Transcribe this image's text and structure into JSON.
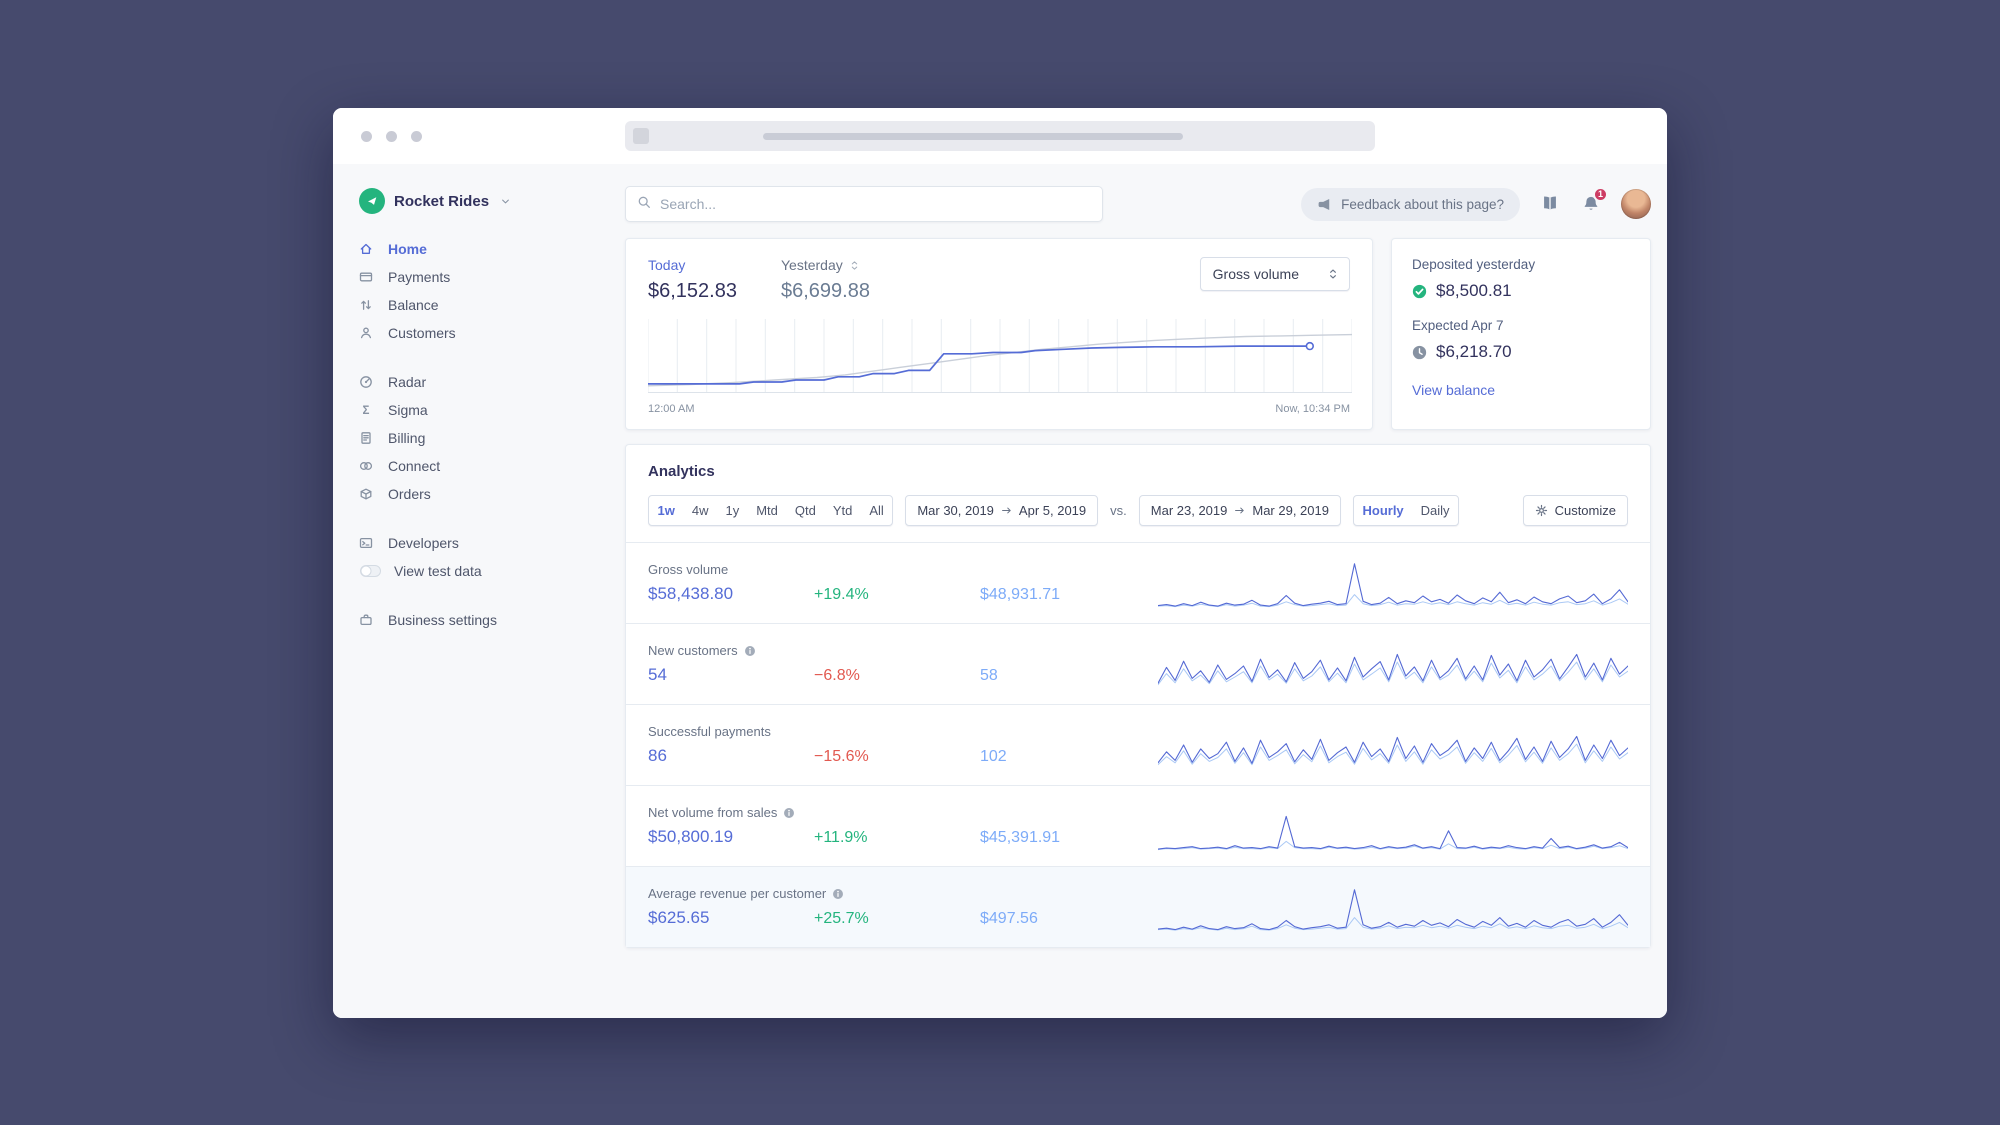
{
  "colors": {
    "accent": "#556cd6",
    "positive": "#24b47e",
    "negative": "#e25950",
    "previous_value": "#7dabf8",
    "brand_green": "#24b47e",
    "spark_current": "#5469d4",
    "spark_previous": "#abc9f5",
    "chart_yesterday": "#c9cfd9"
  },
  "sidebar": {
    "brand": {
      "name": "Rocket Rides"
    },
    "groups": [
      {
        "items": [
          {
            "label": "Home",
            "icon": "home",
            "active": true
          },
          {
            "label": "Payments",
            "icon": "payments"
          },
          {
            "label": "Balance",
            "icon": "balance"
          },
          {
            "label": "Customers",
            "icon": "customers"
          }
        ]
      },
      {
        "items": [
          {
            "label": "Radar",
            "icon": "radar"
          },
          {
            "label": "Sigma",
            "icon": "sigma"
          },
          {
            "label": "Billing",
            "icon": "billing"
          },
          {
            "label": "Connect",
            "icon": "connect"
          },
          {
            "label": "Orders",
            "icon": "orders"
          }
        ]
      },
      {
        "items": [
          {
            "label": "Developers",
            "icon": "developers"
          },
          {
            "label": "View test data",
            "icon": "toggle"
          }
        ]
      },
      {
        "items": [
          {
            "label": "Business settings",
            "icon": "settings"
          }
        ]
      }
    ]
  },
  "topbar": {
    "search_placeholder": "Search...",
    "feedback_label": "Feedback about this page?",
    "bell_badge": "1"
  },
  "overview": {
    "today_label": "Today",
    "today_value": "$6,152.83",
    "yesterday_label": "Yesterday",
    "yesterday_value": "$6,699.88",
    "metric_select": "Gross volume",
    "x_start_label": "12:00 AM",
    "x_end_label": "Now, 10:34 PM",
    "chart": {
      "type": "line",
      "gridlines": 24,
      "series": [
        {
          "name": "Yesterday",
          "points": [
            [
              0,
              5
            ],
            [
              6,
              7
            ],
            [
              12,
              10
            ],
            [
              18,
              14
            ],
            [
              24,
              18
            ],
            [
              28,
              22
            ],
            [
              32,
              28
            ],
            [
              36,
              34
            ],
            [
              40,
              40
            ],
            [
              44,
              46
            ],
            [
              48,
              52
            ],
            [
              52,
              57
            ],
            [
              56,
              62
            ],
            [
              60,
              66
            ],
            [
              64,
              70
            ],
            [
              68,
              73
            ],
            [
              72,
              76
            ],
            [
              76,
              78
            ],
            [
              80,
              80
            ],
            [
              85,
              82
            ],
            [
              90,
              83
            ],
            [
              95,
              84
            ],
            [
              100,
              85
            ]
          ]
        },
        {
          "name": "Today",
          "end_dot": true,
          "points": [
            [
              0,
              8
            ],
            [
              13,
              8
            ],
            [
              15,
              11
            ],
            [
              19,
              11
            ],
            [
              21,
              14
            ],
            [
              25,
              14
            ],
            [
              27,
              19
            ],
            [
              30,
              19
            ],
            [
              32,
              24
            ],
            [
              35,
              24
            ],
            [
              37,
              29
            ],
            [
              40,
              29
            ],
            [
              42,
              55
            ],
            [
              46,
              55
            ],
            [
              49,
              57
            ],
            [
              53,
              57
            ],
            [
              55,
              60
            ],
            [
              59,
              62
            ],
            [
              63,
              64
            ],
            [
              67,
              65
            ],
            [
              72,
              66
            ],
            [
              78,
              66
            ],
            [
              84,
              67
            ],
            [
              90,
              67
            ],
            [
              94,
              67
            ]
          ]
        }
      ]
    }
  },
  "balance_card": {
    "deposited_label": "Deposited yesterday",
    "deposited_value": "$8,500.81",
    "expected_label": "Expected Apr 7",
    "expected_value": "$6,218.70",
    "link": "View balance"
  },
  "analytics": {
    "title": "Analytics",
    "ranges": [
      "1w",
      "4w",
      "1y",
      "Mtd",
      "Qtd",
      "Ytd",
      "All"
    ],
    "active_range": "1w",
    "period_a": {
      "start": "Mar 30, 2019",
      "end": "Apr 5, 2019"
    },
    "vs_label": "vs.",
    "period_b": {
      "start": "Mar 23, 2019",
      "end": "Mar 29, 2019"
    },
    "granularities": [
      "Hourly",
      "Daily"
    ],
    "active_granularity": "Hourly",
    "customize_label": "Customize",
    "metrics": [
      {
        "label": "Gross volume",
        "value": "$58,438.80",
        "delta": "+19.4%",
        "trend": "up",
        "previous": "$48,931.71",
        "info": false,
        "highlight": false,
        "spark": {
          "current": [
            5,
            7,
            4,
            9,
            5,
            12,
            6,
            4,
            10,
            6,
            8,
            16,
            6,
            4,
            9,
            26,
            10,
            5,
            8,
            10,
            14,
            7,
            9,
            92,
            14,
            7,
            10,
            22,
            9,
            15,
            11,
            25,
            13,
            18,
            10,
            27,
            15,
            9,
            21,
            13,
            33,
            11,
            17,
            9,
            23,
            13,
            9,
            19,
            25,
            11,
            15,
            29,
            9,
            19,
            38,
            13
          ],
          "previous": [
            4,
            5,
            3,
            6,
            4,
            8,
            5,
            3,
            7,
            4,
            6,
            10,
            4,
            3,
            6,
            13,
            7,
            4,
            5,
            7,
            9,
            5,
            6,
            28,
            9,
            5,
            7,
            12,
            6,
            9,
            8,
            13,
            8,
            11,
            7,
            13,
            9,
            6,
            11,
            8,
            16,
            7,
            10,
            6,
            12,
            8,
            6,
            11,
            13,
            7,
            9,
            15,
            6,
            11,
            19,
            8
          ]
        }
      },
      {
        "label": "New customers",
        "value": "54",
        "delta": "−6.8%",
        "trend": "down",
        "previous": "58",
        "info": true,
        "highlight": false,
        "spark": {
          "current": [
            12,
            45,
            18,
            58,
            22,
            38,
            14,
            50,
            20,
            32,
            48,
            16,
            62,
            24,
            40,
            15,
            55,
            22,
            36,
            60,
            19,
            44,
            17,
            66,
            25,
            42,
            57,
            19,
            72,
            27,
            46,
            17,
            60,
            23,
            38,
            64,
            21,
            48,
            19,
            70,
            29,
            52,
            17,
            60,
            25,
            40,
            62,
            21,
            46,
            72,
            25,
            54,
            19,
            64,
            31,
            48
          ],
          "previous": [
            9,
            32,
            13,
            42,
            17,
            29,
            11,
            38,
            15,
            25,
            36,
            13,
            48,
            19,
            31,
            12,
            42,
            17,
            27,
            46,
            15,
            33,
            13,
            52,
            19,
            31,
            44,
            15,
            56,
            21,
            35,
            13,
            46,
            19,
            29,
            50,
            17,
            37,
            15,
            54,
            23,
            39,
            13,
            46,
            19,
            31,
            48,
            17,
            35,
            56,
            19,
            42,
            15,
            50,
            25,
            37
          ]
        }
      },
      {
        "label": "Successful payments",
        "value": "86",
        "delta": "−15.6%",
        "trend": "down",
        "previous": "102",
        "info": false,
        "highlight": false,
        "spark": {
          "current": [
            15,
            38,
            20,
            52,
            16,
            44,
            24,
            34,
            58,
            18,
            46,
            14,
            62,
            26,
            38,
            55,
            17,
            42,
            22,
            64,
            20,
            36,
            48,
            16,
            58,
            28,
            44,
            18,
            68,
            24,
            50,
            16,
            55,
            30,
            42,
            62,
            18,
            46,
            24,
            58,
            20,
            40,
            66,
            22,
            48,
            18,
            60,
            26,
            44,
            70,
            20,
            52,
            24,
            62,
            30,
            46
          ],
          "previous": [
            11,
            28,
            15,
            40,
            12,
            34,
            18,
            26,
            44,
            14,
            36,
            11,
            48,
            20,
            30,
            42,
            13,
            32,
            17,
            50,
            15,
            28,
            37,
            12,
            45,
            21,
            34,
            14,
            52,
            18,
            38,
            12,
            42,
            23,
            32,
            48,
            14,
            36,
            18,
            45,
            15,
            31,
            51,
            17,
            37,
            14,
            46,
            20,
            34,
            54,
            15,
            40,
            18,
            48,
            23,
            36
          ]
        }
      },
      {
        "label": "Net volume from sales",
        "value": "$50,800.19",
        "delta": "+11.9%",
        "trend": "up",
        "previous": "$45,391.91",
        "info": true,
        "highlight": false,
        "spark": {
          "current": [
            4,
            6,
            5,
            7,
            9,
            5,
            6,
            8,
            5,
            11,
            6,
            7,
            5,
            9,
            6,
            72,
            9,
            6,
            7,
            5,
            10,
            6,
            8,
            5,
            7,
            11,
            5,
            9,
            6,
            8,
            13,
            6,
            9,
            5,
            42,
            7,
            6,
            10,
            5,
            8,
            6,
            11,
            7,
            5,
            9,
            6,
            26,
            7,
            10,
            5,
            8,
            13,
            6,
            9,
            18,
            7
          ],
          "previous": [
            3,
            5,
            4,
            5,
            7,
            4,
            5,
            6,
            4,
            8,
            5,
            5,
            4,
            7,
            5,
            20,
            7,
            5,
            5,
            4,
            8,
            5,
            6,
            4,
            5,
            8,
            4,
            7,
            5,
            6,
            10,
            5,
            7,
            4,
            15,
            5,
            5,
            8,
            4,
            6,
            5,
            8,
            5,
            4,
            7,
            5,
            12,
            5,
            8,
            4,
            6,
            10,
            5,
            7,
            11,
            5
          ]
        }
      },
      {
        "label": "Average revenue per customer",
        "value": "$625.65",
        "delta": "+25.7%",
        "trend": "up",
        "previous": "$497.56",
        "info": true,
        "highlight": true,
        "spark": {
          "current": [
            6,
            8,
            5,
            10,
            6,
            13,
            7,
            5,
            11,
            7,
            9,
            17,
            7,
            5,
            10,
            24,
            11,
            6,
            9,
            11,
            15,
            8,
            10,
            88,
            15,
            8,
            11,
            20,
            10,
            16,
            12,
            24,
            14,
            19,
            11,
            26,
            16,
            10,
            22,
            14,
            30,
            12,
            18,
            10,
            24,
            14,
            10,
            20,
            26,
            12,
            16,
            28,
            10,
            20,
            36,
            14
          ],
          "previous": [
            5,
            6,
            4,
            7,
            5,
            9,
            6,
            4,
            8,
            5,
            7,
            12,
            5,
            4,
            7,
            15,
            8,
            5,
            6,
            8,
            10,
            6,
            7,
            30,
            10,
            6,
            8,
            13,
            7,
            10,
            9,
            14,
            9,
            12,
            8,
            14,
            10,
            7,
            12,
            9,
            17,
            8,
            11,
            7,
            13,
            9,
            7,
            12,
            14,
            8,
            10,
            16,
            7,
            12,
            20,
            9
          ]
        }
      }
    ]
  }
}
